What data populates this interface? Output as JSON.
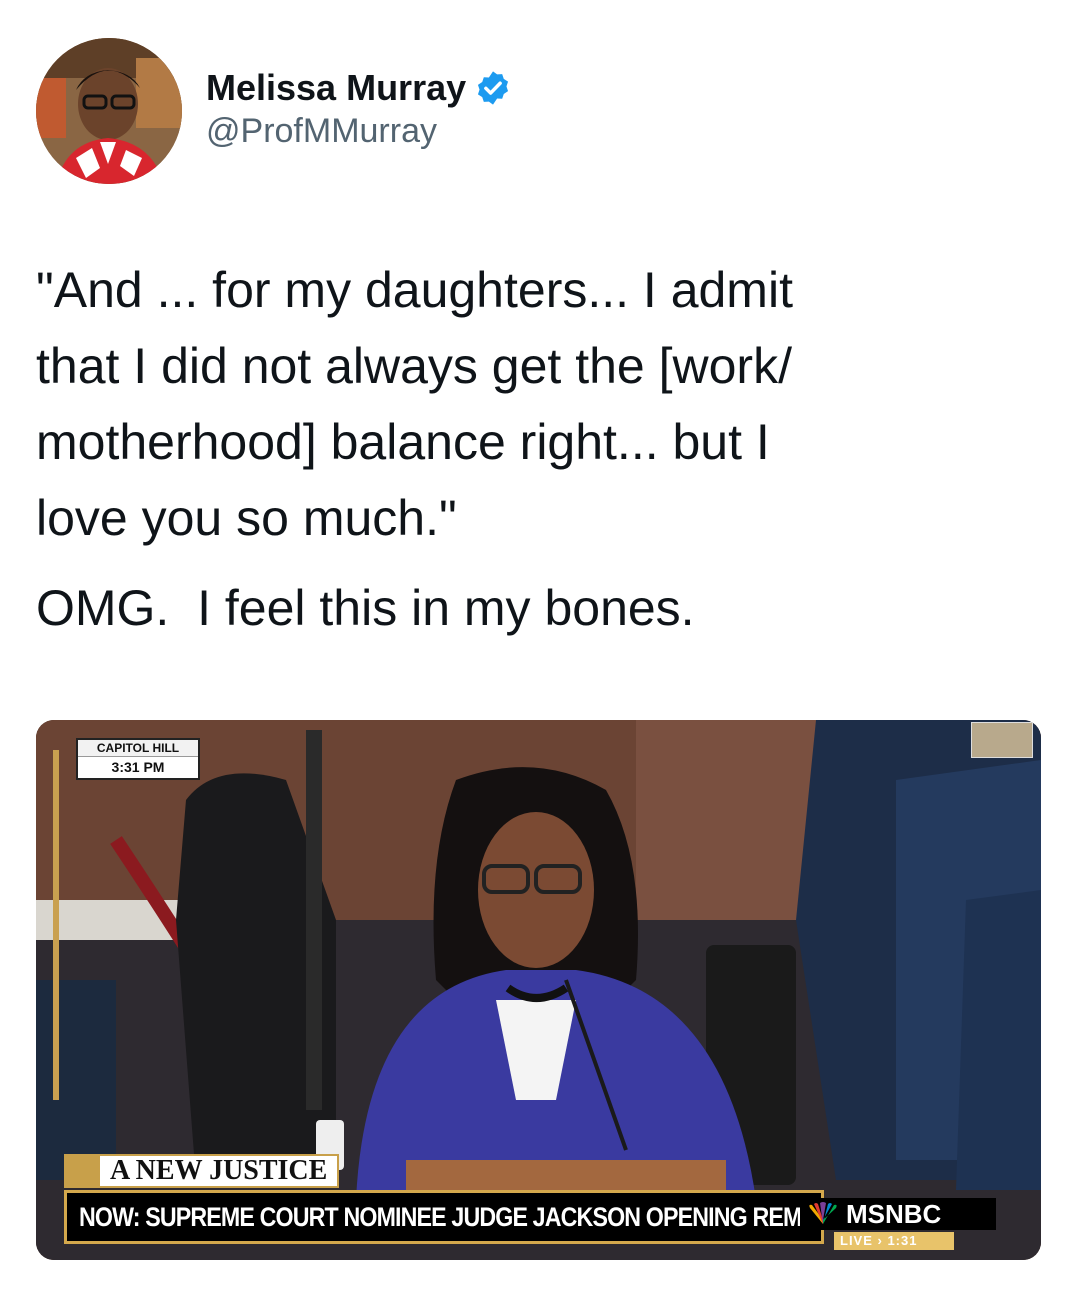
{
  "author": {
    "display_name": "Melissa Murray",
    "handle": "@ProfMMurray",
    "verified_icon": "verified-badge-icon",
    "accent_color": "#1d9bf0"
  },
  "tweet": {
    "paragraph_1": "\"And ... for my daughters... I admit\nthat I did not always get the [work/\nmotherhood] balance right... but I\nlove you so much.\"",
    "paragraph_2": "OMG.  I feel this in my bones."
  },
  "media": {
    "location_label": "CAPITOL HILL",
    "location_time": "3:31 PM",
    "show_title": "A NEW JUSTICE",
    "headline": "NOW: SUPREME COURT NOMINEE JUDGE JACKSON OPENING REMARKS",
    "network": "MSNBC",
    "live_label": "LIVE › 1:31"
  }
}
